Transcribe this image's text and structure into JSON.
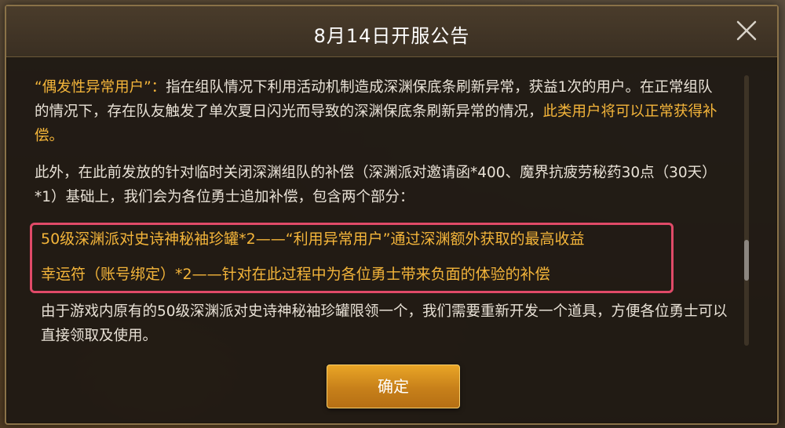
{
  "dialog": {
    "title": "8月14日开服公告",
    "close_icon": "close-icon",
    "confirm_label": "确定"
  },
  "content": {
    "para1_highlight": "“偶发性异常用户”：",
    "para1_text": "指在组队情况下利用活动机制造成深渊保底条刷新异常，获益1次的用户。在正常组队的情况下，存在队友触发了单次夏日闪光而导致的深渊保底条刷新异常的情况，",
    "para1_gold_end": "此类用户将可以正常获得补偿。",
    "para2_text": "此外，在此前发放的针对临时关闭深渊组队的补偿（深渊派对邀请函*400、魔界抗疲劳秘药30点（30天）*1）基础上，我们会为各位勇士追加补偿，包含两个部分：",
    "highlight_line1": "50级深渊派对史诗神秘袖珍罐*2——“利用异常用户”通过深渊额外获取的最高收益",
    "highlight_line2": "幸运符（账号绑定）*2——针对在此过程中为各位勇士带来负面的体验的补偿",
    "para3_text": "由于游戏内原有的50级深渊派对史诗神秘袖珍罐限领一个，我们需要重新开发一个道具，方便各位勇士可以直接领取及使用。"
  },
  "colors": {
    "accent_gold": "#f4b53a",
    "highlight_border": "#e04a68",
    "button": "#d9921f"
  }
}
